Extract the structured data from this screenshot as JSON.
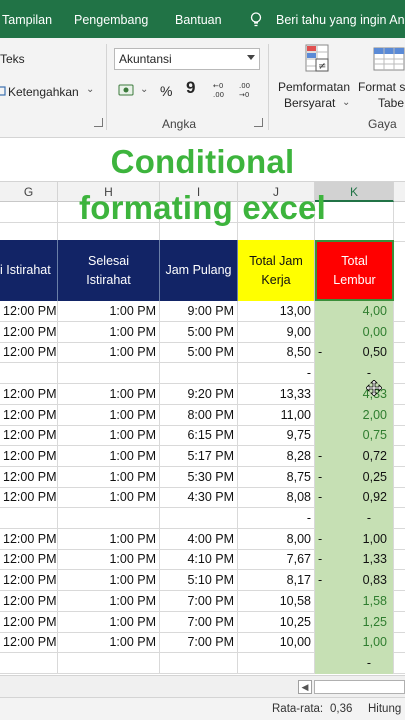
{
  "ribbon_tabs": [
    "Tampilan",
    "Pengembang",
    "Bantuan"
  ],
  "tell_me": "Beri tahu yang ingin An",
  "ribbon": {
    "wrap_text": "Teks",
    "merge_center": "Ketengahkan",
    "number_format": "Akuntansi",
    "percent": "%",
    "comma": "9",
    "angka_label": "Angka",
    "cond_format_line1": "Pemformatan",
    "cond_format_line2": "Bersyarat",
    "format_table_line1": "Format s",
    "format_table_line2": "Tabe",
    "gaya_label": "Gaya"
  },
  "caption": {
    "line1": "Conditional",
    "line2": "formating excel"
  },
  "columns": [
    "G",
    "H",
    "I",
    "J",
    "K"
  ],
  "headers": {
    "g": "i Istirahat",
    "h": "Selesai Istirahat",
    "i": "Jam Pulang",
    "j": "Total Jam Kerja",
    "k": "Total Lembur"
  },
  "rows": [
    {
      "g": "12:00 PM",
      "h": "1:00 PM",
      "i": "9:00 PM",
      "j": "13,00",
      "k": "4,00",
      "neg": false
    },
    {
      "g": "12:00 PM",
      "h": "1:00 PM",
      "i": "5:00 PM",
      "j": "9,00",
      "k": "0,00",
      "neg": false
    },
    {
      "g": "12:00 PM",
      "h": "1:00 PM",
      "i": "5:00 PM",
      "j": "8,50",
      "k": "0,50",
      "neg": true
    },
    {
      "g": "",
      "h": "",
      "i": "",
      "j": "-",
      "k": "-",
      "neg": false
    },
    {
      "g": "12:00 PM",
      "h": "1:00 PM",
      "i": "9:20 PM",
      "j": "13,33",
      "k": "4,33",
      "neg": false
    },
    {
      "g": "12:00 PM",
      "h": "1:00 PM",
      "i": "8:00 PM",
      "j": "11,00",
      "k": "2,00",
      "neg": false
    },
    {
      "g": "12:00 PM",
      "h": "1:00 PM",
      "i": "6:15 PM",
      "j": "9,75",
      "k": "0,75",
      "neg": false
    },
    {
      "g": "12:00 PM",
      "h": "1:00 PM",
      "i": "5:17 PM",
      "j": "8,28",
      "k": "0,72",
      "neg": true
    },
    {
      "g": "12:00 PM",
      "h": "1:00 PM",
      "i": "5:30 PM",
      "j": "8,75",
      "k": "0,25",
      "neg": true
    },
    {
      "g": "12:00 PM",
      "h": "1:00 PM",
      "i": "4:30 PM",
      "j": "8,08",
      "k": "0,92",
      "neg": true
    },
    {
      "g": "",
      "h": "",
      "i": "",
      "j": "-",
      "k": "-",
      "neg": false
    },
    {
      "g": "12:00 PM",
      "h": "1:00 PM",
      "i": "4:00 PM",
      "j": "8,00",
      "k": "1,00",
      "neg": true
    },
    {
      "g": "12:00 PM",
      "h": "1:00 PM",
      "i": "4:10 PM",
      "j": "7,67",
      "k": "1,33",
      "neg": true
    },
    {
      "g": "12:00 PM",
      "h": "1:00 PM",
      "i": "5:10 PM",
      "j": "8,17",
      "k": "0,83",
      "neg": true
    },
    {
      "g": "12:00 PM",
      "h": "1:00 PM",
      "i": "7:00 PM",
      "j": "10,58",
      "k": "1,58",
      "neg": false
    },
    {
      "g": "12:00 PM",
      "h": "1:00 PM",
      "i": "7:00 PM",
      "j": "10,25",
      "k": "1,25",
      "neg": false
    },
    {
      "g": "12:00 PM",
      "h": "1:00 PM",
      "i": "7:00 PM",
      "j": "10,00",
      "k": "1,00",
      "neg": false
    },
    {
      "g": "",
      "h": "",
      "i": "",
      "j": "",
      "k": "-",
      "neg": false
    }
  ],
  "status": {
    "average_label": "Rata-rata:",
    "average_value": "0,36",
    "count_label": "Hitung"
  },
  "colors": {
    "excel_green": "#217346",
    "header_navy": "#122466",
    "header_yellow": "#ffff00",
    "header_red": "#ff0000",
    "cf_fill": "#c6e0b4",
    "caption_green": "#3db43d"
  }
}
